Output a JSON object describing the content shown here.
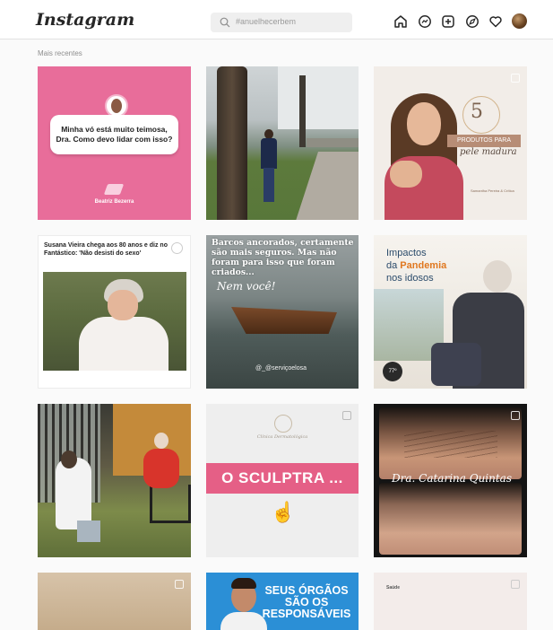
{
  "header": {
    "logo": "Instagram",
    "search_placeholder": "#anuelhecerbem"
  },
  "section_label": "Mais recentes",
  "posts": [
    {
      "bubble": "Minha vó está muito teimosa, Dra. Como devo lidar com isso?",
      "brand": "Beatriz Bezerra"
    },
    {},
    {
      "number": "5",
      "ribbon": "PRODUTOS PARA",
      "line2": "pele madura",
      "footer": "Samantha Pereira & Crítica"
    },
    {
      "headline": "Susana Vieira chega aos 80 anos e diz no Fantástico: 'Não desisti do sexo'"
    },
    {
      "text": "Barcos ancorados, certamente são mais seguros. Mas não foram para isso que foram criados...",
      "script": "Nem você!",
      "handle": "@_@serviçoelosa"
    },
    {
      "title_line1": "Impactos",
      "title_da": "da ",
      "title_highlight": "Pandemia",
      "title_line3": "nos idosos",
      "badge": "77º"
    },
    {},
    {
      "firm": "Clínica Dermatológica",
      "band": "O SCULPTRA ..."
    },
    {
      "signature": "Dra. Catarina Quintas"
    },
    {},
    {
      "text": "SEUS ÓRGÃOS SÃO OS RESPONSÁVEIS"
    },
    {
      "label": "Saúde"
    }
  ]
}
